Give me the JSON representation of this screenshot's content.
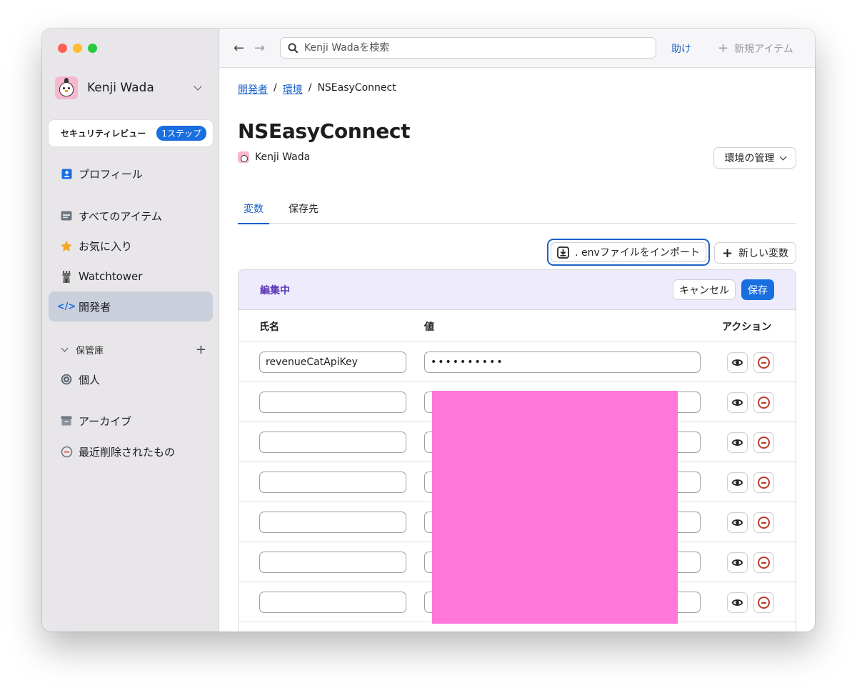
{
  "sidebar": {
    "account_name": "Kenji Wada",
    "security_review": {
      "label": "セキュリティレビュー",
      "badge": "1ステップ"
    },
    "items": [
      {
        "label": "プロフィール",
        "icon": "profile-icon"
      },
      {
        "label": "すべてのアイテム",
        "icon": "all-items-icon"
      },
      {
        "label": "お気に入り",
        "icon": "star-icon"
      },
      {
        "label": "Watchtower",
        "icon": "watchtower-icon"
      },
      {
        "label": "開発者",
        "icon": "code-icon",
        "active": true
      },
      {
        "label": "個人",
        "icon": "vault-icon"
      },
      {
        "label": "アーカイブ",
        "icon": "archive-icon"
      },
      {
        "label": "最近削除されたもの",
        "icon": "deleted-icon"
      }
    ],
    "vault_section": "保管庫"
  },
  "toolbar": {
    "search_placeholder": "Kenji Wadaを検索",
    "help": "助け",
    "new_item": "新規アイテム"
  },
  "breadcrumb": {
    "part1": "開発者",
    "part2": "環境",
    "current": "NSEasyConnect",
    "sep": "/"
  },
  "page": {
    "title": "NSEasyConnect",
    "owner": "Kenji Wada",
    "manage_button": "環境の管理"
  },
  "tabs": [
    "変数",
    "保存先"
  ],
  "actions": {
    "import_env": ". envファイルをインポート",
    "new_variable": "新しい変数"
  },
  "editor": {
    "status": "編集中",
    "cancel": "キャンセル",
    "save": "保存",
    "columns": {
      "name": "氏名",
      "value": "値",
      "actions": "アクション"
    },
    "rows": [
      {
        "name": "revenueCatApiKey",
        "value": "••••••••••"
      },
      {
        "name": "",
        "value": ""
      },
      {
        "name": "",
        "value": ""
      },
      {
        "name": "",
        "value": ""
      },
      {
        "name": "",
        "value": ""
      },
      {
        "name": "",
        "value": ""
      },
      {
        "name": "",
        "value": ""
      }
    ]
  },
  "colors": {
    "accent": "#1a6fe0",
    "editing_header_bg": "#eeecfc",
    "editing_text": "#5a37b5",
    "sidebar_bg": "#e8e6e9",
    "redaction": "#ff77d9"
  }
}
